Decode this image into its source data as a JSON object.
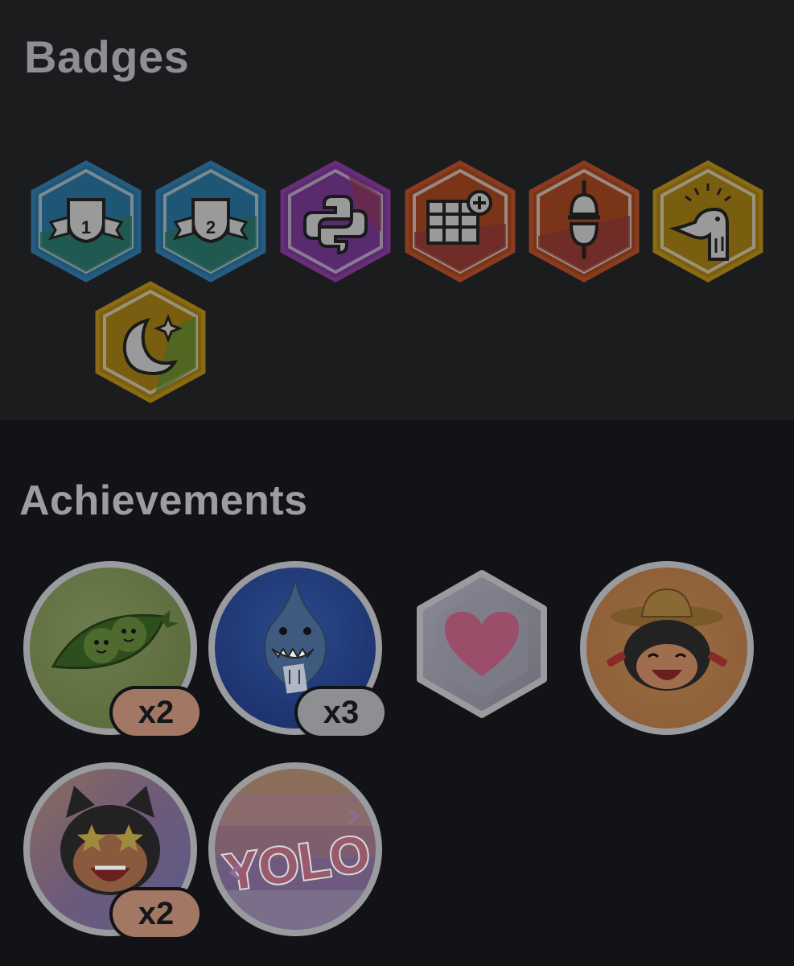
{
  "badges": {
    "title": "Badges",
    "items": [
      {
        "icon": "trophy-1-icon",
        "label": "1",
        "color": "#2b6a94"
      },
      {
        "icon": "trophy-2-icon",
        "label": "2",
        "color": "#2b6a94"
      },
      {
        "icon": "python-icon",
        "color": "#6a2d7a"
      },
      {
        "icon": "table-plus-icon",
        "color": "#8a3c20"
      },
      {
        "icon": "spark-plug-icon",
        "color": "#8a3c20"
      },
      {
        "icon": "goose-icon",
        "color": "#8a6a12"
      },
      {
        "icon": "moon-star-icon",
        "color": "#8a6a12"
      }
    ]
  },
  "achievements": {
    "title": "Achievements",
    "items": [
      {
        "icon": "pea-pod-icon",
        "count": "x2",
        "pill_color": "#a27865"
      },
      {
        "icon": "shark-icon",
        "count": "x3",
        "pill_color": "#8e8f92"
      },
      {
        "icon": "heart-icon"
      },
      {
        "icon": "cowboy-cat-icon"
      },
      {
        "icon": "star-eyes-cat-icon",
        "count": "x2",
        "pill_color": "#a27865"
      },
      {
        "icon": "yolo-icon",
        "label": "YOLO"
      }
    ]
  }
}
